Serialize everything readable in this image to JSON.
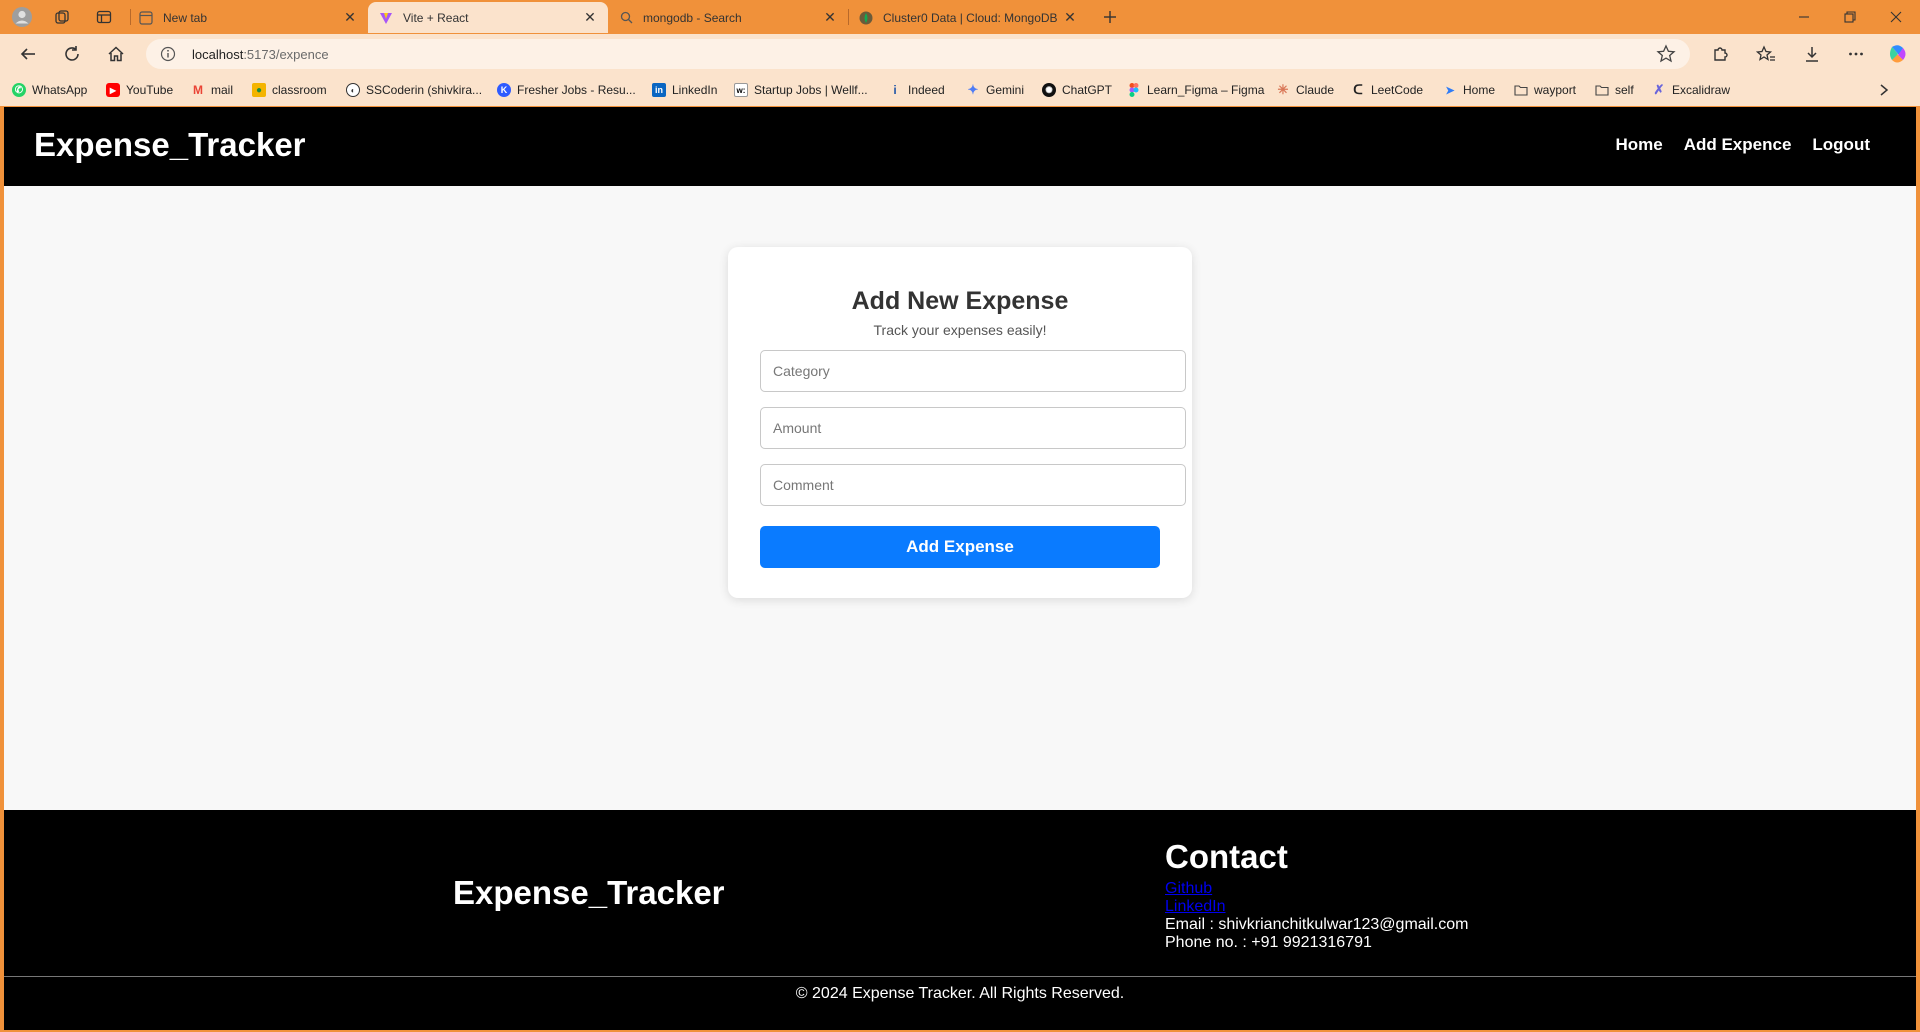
{
  "browser": {
    "tabs": [
      {
        "title": "New tab",
        "favicon": "new-tab-icon"
      },
      {
        "title": "Vite + React",
        "favicon": "vite-icon"
      },
      {
        "title": "mongodb - Search",
        "favicon": "search-icon"
      },
      {
        "title": "Cluster0 Data | Cloud: MongoDB",
        "favicon": "mongodb-icon"
      }
    ],
    "url_host": "localhost",
    "url_path": ":5173/expence",
    "bookmarks": [
      {
        "label": "WhatsApp",
        "icon": "whatsapp-icon",
        "color": "#25d366"
      },
      {
        "label": "YouTube",
        "icon": "youtube-icon",
        "color": "#ff0000"
      },
      {
        "label": "mail",
        "icon": "gmail-icon",
        "color": "#ea4335"
      },
      {
        "label": "classroom",
        "icon": "classroom-icon",
        "color": "#f4b400"
      },
      {
        "label": "SSCoderin (shivkira...",
        "icon": "github-icon",
        "color": "#333333"
      },
      {
        "label": "Fresher Jobs - Resu...",
        "icon": "fresher-jobs-icon",
        "color": "#2e5bff"
      },
      {
        "label": "LinkedIn",
        "icon": "linkedin-icon",
        "color": "#0a66c2"
      },
      {
        "label": "Startup Jobs | Wellf...",
        "icon": "wellfound-icon",
        "color": "#000000"
      },
      {
        "label": "Indeed",
        "icon": "indeed-icon",
        "color": "#2557a7"
      },
      {
        "label": "Gemini",
        "icon": "gemini-icon",
        "color": "#4e7cf5"
      },
      {
        "label": "ChatGPT",
        "icon": "chatgpt-icon",
        "color": "#111111"
      },
      {
        "label": "Learn_Figma – Figma",
        "icon": "figma-icon",
        "color": "#a259ff"
      },
      {
        "label": "Claude",
        "icon": "claude-icon",
        "color": "#d97757"
      },
      {
        "label": "LeetCode",
        "icon": "leetcode-icon",
        "color": "#222222"
      },
      {
        "label": "Home",
        "icon": "home-bookmark-icon",
        "color": "#2f7cf6"
      },
      {
        "label": "wayport",
        "icon": "folder-icon",
        "color": "#444444"
      },
      {
        "label": "self",
        "icon": "folder-icon",
        "color": "#444444"
      },
      {
        "label": "Excalidraw",
        "icon": "excalidraw-icon",
        "color": "#6965db"
      }
    ]
  },
  "navbar": {
    "brand": "Expense_Tracker",
    "links": [
      "Home",
      "Add Expence",
      "Logout"
    ]
  },
  "form": {
    "title": "Add New Expense",
    "subtitle": "Track your expenses easily!",
    "category_placeholder": "Category",
    "amount_placeholder": "Amount",
    "comment_placeholder": "Comment",
    "submit_label": "Add Expense",
    "accent_color": "#0a7bff"
  },
  "footer": {
    "brand": "Expense_Tracker",
    "contact_title": "Contact",
    "github_label": "Github",
    "linkedin_label": "LinkedIn",
    "email": "Email : shivkrianchitkulwar123@gmail.com",
    "phone": "Phone no. : +91 9921316791",
    "copyright": "© 2024 Expense Tracker. All Rights Reserved."
  }
}
